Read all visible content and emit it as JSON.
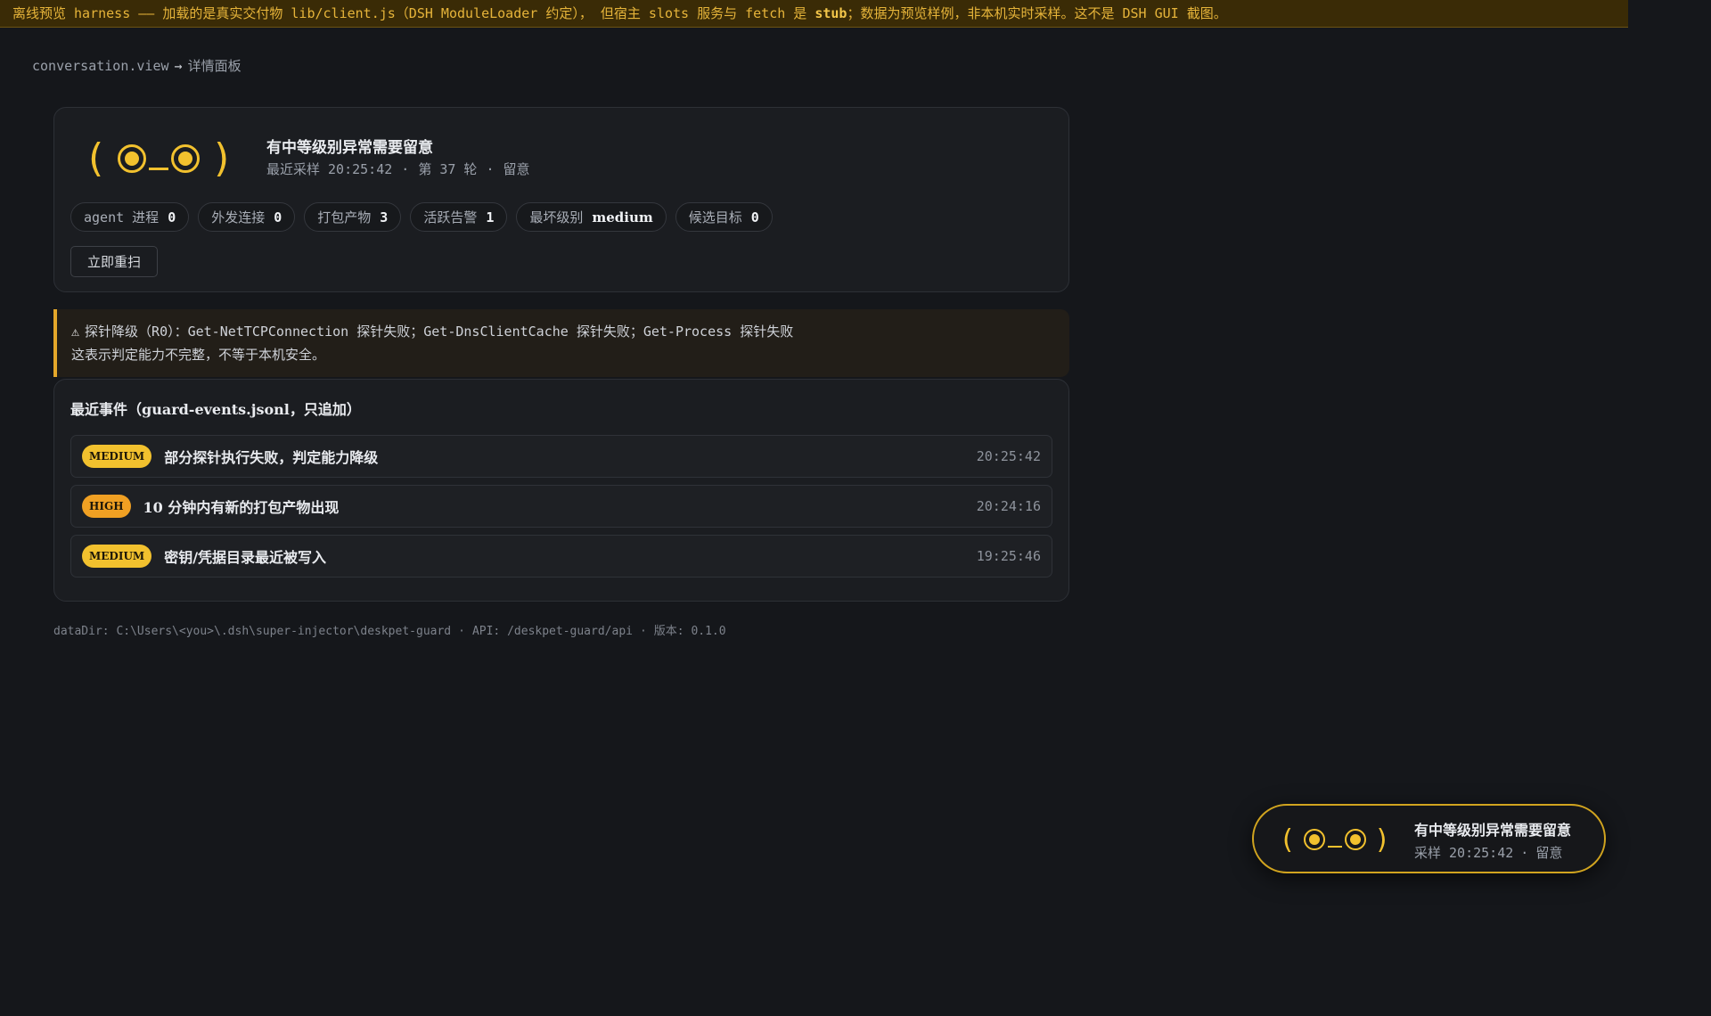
{
  "banner": {
    "text_before": "离线预览 harness —— 加载的是真实交付物 lib/client.js（DSH ModuleLoader 约定），  但宿主 slots 服务与 fetch 是 ",
    "text_bold": "stub",
    "text_after": "；数据为预览样例，非本机实时采样。这不是 DSH GUI 截图。"
  },
  "breadcrumb": {
    "view": "conversation.view",
    "arrow": "→",
    "panel": "详情面板"
  },
  "status": {
    "title": "有中等级别异常需要留意",
    "sample_label": "最近采样 20:25:42",
    "round_label": "第 37 轮",
    "state_label": "留意",
    "separator": "·",
    "face": {
      "left_paren": "(",
      "right_paren": ")"
    },
    "pills": [
      {
        "label": "agent 进程",
        "value": "0"
      },
      {
        "label": "外发连接",
        "value": "0"
      },
      {
        "label": "打包产物",
        "value": "3"
      },
      {
        "label": "活跃告警",
        "value": "1"
      },
      {
        "label": "最坏级别",
        "value": "medium"
      },
      {
        "label": "候选目标",
        "value": "0"
      }
    ],
    "rescan_label": "立即重扫"
  },
  "warning": {
    "icon": "⚠",
    "line1": "探针降级（R0）：Get-NetTCPConnection 探针失败；Get-DnsClientCache 探针失败；Get-Process 探针失败",
    "line2": "这表示判定能力不完整，不等于本机安全。"
  },
  "events": {
    "title": "最近事件（guard-events.jsonl，只追加）",
    "items": [
      {
        "severity": "MEDIUM",
        "message": "部分探针执行失败，判定能力降级",
        "time": "20:25:42"
      },
      {
        "severity": "HIGH",
        "message": "10 分钟内有新的打包产物出现",
        "time": "20:24:16"
      },
      {
        "severity": "MEDIUM",
        "message": "密钥/凭据目录最近被写入",
        "time": "19:25:46"
      }
    ]
  },
  "footer": {
    "data_dir": "dataDir: C:\\Users\\<you>\\.dsh\\super-injector\\deskpet-guard",
    "api": "API: /deskpet-guard/api",
    "version": "版本: 0.1.0",
    "separator": "·"
  },
  "mini": {
    "title": "有中等级别异常需要留意",
    "sample": "采样 20:25:42",
    "state": "留意",
    "separator": "·"
  },
  "colors": {
    "accent": "#f2c12e",
    "medium": "#f2c12e",
    "high": "#f0a023",
    "warning_border": "#e4a72a"
  }
}
